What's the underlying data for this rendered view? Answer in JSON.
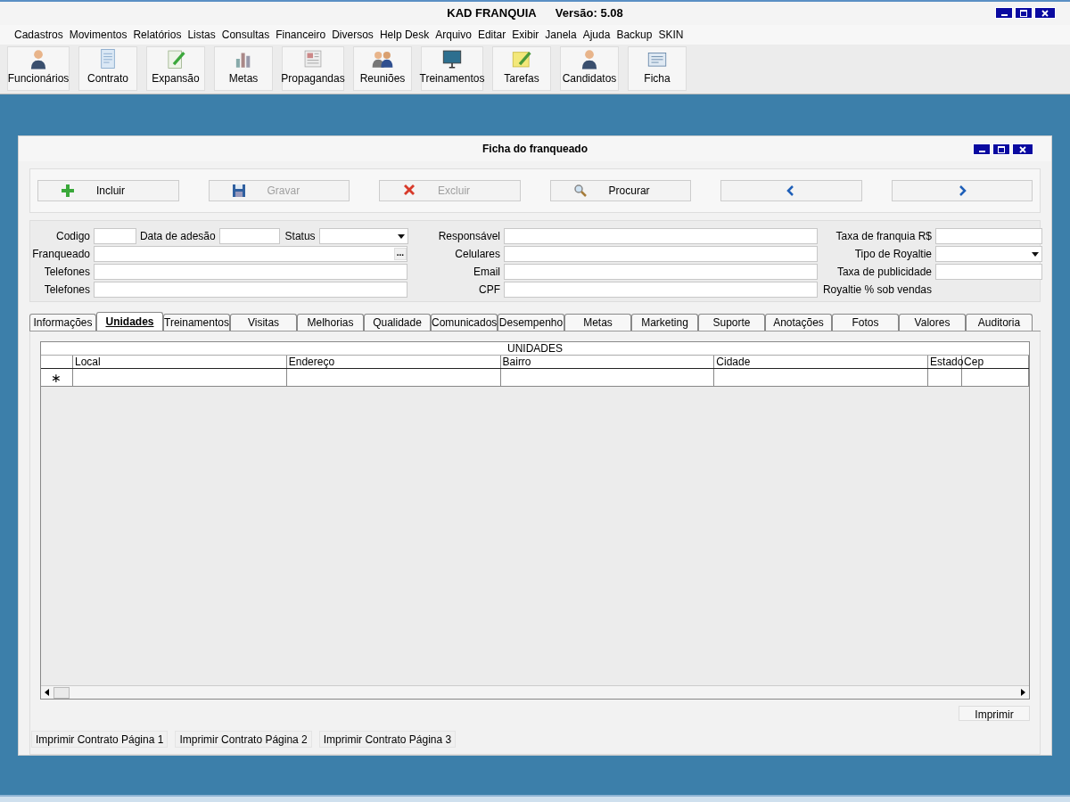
{
  "app_title": "KAD FRANQUIA      Versão: 5.08",
  "menu": [
    "Cadastros",
    "Movimentos",
    "Relatórios",
    "Listas",
    "Consultas",
    "Financeiro",
    "Diversos",
    "Help Desk",
    "Arquivo",
    "Editar",
    "Exibir",
    "Janela",
    "Ajuda",
    "Backup",
    "SKIN"
  ],
  "toolbar": [
    {
      "label": "Funcionários",
      "kind": "person"
    },
    {
      "label": "Contrato",
      "kind": "document"
    },
    {
      "label": "Expansão",
      "kind": "edit"
    },
    {
      "label": "Metas",
      "kind": "chart"
    },
    {
      "label": "Propagandas",
      "kind": "newspaper"
    },
    {
      "label": "Reuniões",
      "kind": "people"
    },
    {
      "label": "Treinamentos",
      "kind": "monitor"
    },
    {
      "label": "Tarefas",
      "kind": "note"
    },
    {
      "label": "Candidatos",
      "kind": "person"
    },
    {
      "label": "Ficha",
      "kind": "card"
    }
  ],
  "window": {
    "title": "Ficha do franqueado"
  },
  "actions": [
    {
      "label": "Incluir",
      "kind": "add",
      "disabled": false
    },
    {
      "label": "Gravar",
      "kind": "save",
      "disabled": true
    },
    {
      "label": "Excluir",
      "kind": "delete",
      "disabled": true
    },
    {
      "label": "Procurar",
      "kind": "search",
      "disabled": false
    },
    {
      "kind": "prev"
    },
    {
      "kind": "next"
    }
  ],
  "form": {
    "left": [
      [
        {
          "label": "Codigo",
          "kind": "text"
        },
        {
          "label": "Data de adesão",
          "kind": "text"
        },
        {
          "label": "Status",
          "kind": "combo"
        }
      ],
      [
        {
          "label": "Franqueado",
          "kind": "lookup",
          "button": "..."
        }
      ],
      [
        {
          "label": "Telefones",
          "kind": "text"
        }
      ],
      [
        {
          "label": "Telefones",
          "kind": "text"
        }
      ]
    ],
    "middle": [
      {
        "label": "Responsável",
        "kind": "text"
      },
      {
        "label": "Celulares",
        "kind": "text"
      },
      {
        "label": "Email",
        "kind": "text"
      },
      {
        "label": "CPF",
        "kind": "text"
      }
    ],
    "right": [
      {
        "label": "Taxa de franquia R$",
        "kind": "text"
      },
      {
        "label": "Tipo de Royaltie",
        "kind": "combo"
      },
      {
        "label": "Taxa de publicidade",
        "kind": "text"
      },
      {
        "label": "Royaltie % sob vendas",
        "kind": "none"
      }
    ]
  },
  "tabs": [
    {
      "label": "Informações",
      "selected": false
    },
    {
      "label": "Unidades",
      "selected": true
    },
    {
      "label": "Treinamentos",
      "selected": false
    },
    {
      "label": "Visitas",
      "selected": false
    },
    {
      "label": "Melhorias",
      "selected": false
    },
    {
      "label": "Qualidade",
      "selected": false
    },
    {
      "label": "Comunicados",
      "selected": false
    },
    {
      "label": "Desempenho",
      "selected": false
    },
    {
      "label": "Metas",
      "selected": false
    },
    {
      "label": "Marketing",
      "selected": false
    },
    {
      "label": "Suporte",
      "selected": false
    },
    {
      "label": "Anotações",
      "selected": false
    },
    {
      "label": "Fotos",
      "selected": false
    },
    {
      "label": "Valores",
      "selected": false
    },
    {
      "label": "Auditoria",
      "selected": false
    }
  ],
  "table": {
    "title": "UNIDADES",
    "columns": [
      "Local",
      "Endereço",
      "Bairro",
      "Cidade",
      "Estado",
      "Cep"
    ],
    "new_row_marker": "∗"
  },
  "print_button": "Imprimir",
  "contract_buttons": [
    "Imprimir Contrato Página 1",
    "Imprimir Contrato Página 2",
    "Imprimir Contrato Página 3"
  ]
}
